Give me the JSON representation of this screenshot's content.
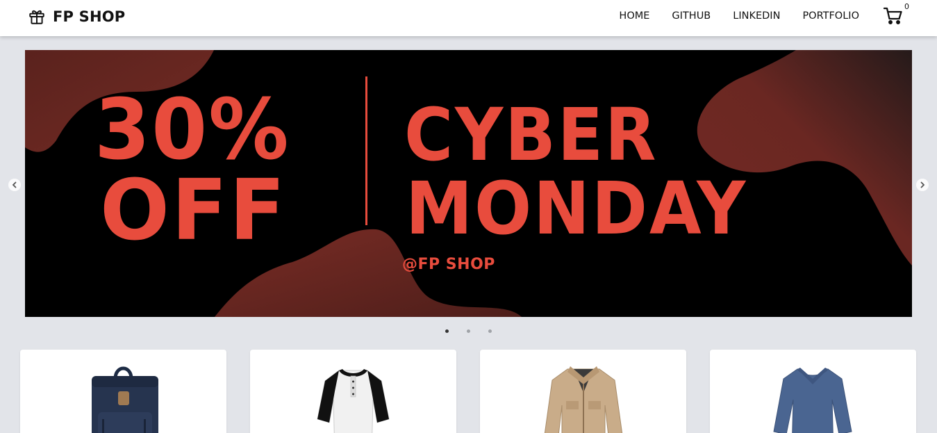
{
  "brand": {
    "name": "FP SHOP",
    "icon": "gift-icon"
  },
  "nav": {
    "links": [
      "HOME",
      "GITHUB",
      "LINKEDIN",
      "PORTFOLIO"
    ],
    "cart_count": "0",
    "cart_icon": "cart-icon"
  },
  "banner": {
    "line1": "30%",
    "line2": "OFF",
    "line3": "CYBER",
    "line4": "MONDAY",
    "handle": "@FP SHOP",
    "accent_color": "#e84c3d",
    "background_color": "#000000"
  },
  "carousel": {
    "slide_count": 3,
    "active_slide": 1
  },
  "products": [
    {
      "image": "navy-backpack"
    },
    {
      "image": "black-white-henley-shirt"
    },
    {
      "image": "beige-jacket"
    },
    {
      "image": "blue-long-sleeve-shirt"
    }
  ]
}
